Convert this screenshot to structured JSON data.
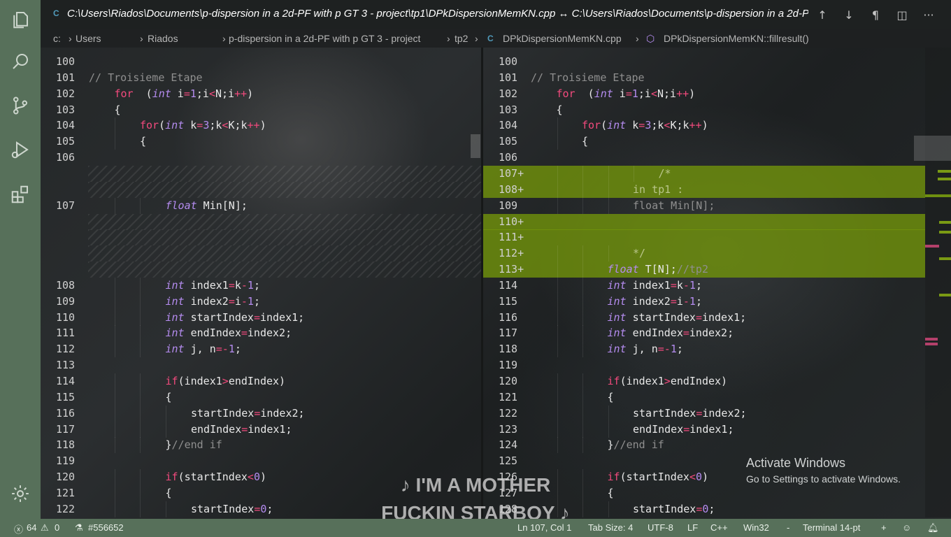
{
  "titlebar": {
    "file_icon": "C",
    "title": "C:\\Users\\Riados\\Documents\\p-dispersion in a 2d-PF with p GT 3 - project\\tp1\\DPkDispersionMemKN.cpp ↔ C:\\Users\\Riados\\Documents\\p-dispersion in a 2d-PF with p GT 3 - project\\tp2\\DPkDispersionMemKN.cpp",
    "icons": [
      "arrow-up-icon",
      "arrow-down-icon",
      "pilcrow-icon",
      "split-editor-icon",
      "more-icon"
    ]
  },
  "breadcrumb": {
    "items": [
      "c:",
      "Users",
      "Riados",
      "Documents",
      "p-dispersion in a 2d-PF with p GT 3 - project",
      "tp2",
      "DPkDispersionMemKN.cpp",
      "DPkDispersionMemKN::fillresult()"
    ],
    "file_icon": "C"
  },
  "activity_bar": {
    "icons": [
      "explorer-icon",
      "search-icon",
      "source-control-icon",
      "run-debug-icon",
      "extensions-icon",
      "settings-gear-icon"
    ]
  },
  "left_lines": [
    {
      "n": "100",
      "indent": 0,
      "tokens": []
    },
    {
      "n": "101",
      "indent": 0,
      "tokens": [
        [
          "cm",
          "// Troisieme Etape"
        ]
      ]
    },
    {
      "n": "102",
      "indent": 1,
      "tokens": [
        [
          "kw",
          "for"
        ],
        [
          "",
          "  ("
        ],
        [
          "ty",
          "int"
        ],
        [
          "",
          " i"
        ],
        [
          "op",
          "="
        ],
        [
          "num",
          "1"
        ],
        [
          "",
          ";i"
        ],
        [
          "op",
          "<"
        ],
        [
          "",
          "N;i"
        ],
        [
          "op",
          "++"
        ],
        [
          "",
          ")"
        ]
      ]
    },
    {
      "n": "103",
      "indent": 1,
      "tokens": [
        [
          "",
          "{"
        ]
      ]
    },
    {
      "n": "104",
      "indent": 2,
      "tokens": [
        [
          "kw",
          "for"
        ],
        [
          "",
          "("
        ],
        [
          "ty",
          "int"
        ],
        [
          "",
          " k"
        ],
        [
          "op",
          "="
        ],
        [
          "num",
          "3"
        ],
        [
          "",
          ";k"
        ],
        [
          "op",
          "<"
        ],
        [
          "",
          "K;k"
        ],
        [
          "op",
          "++"
        ],
        [
          "",
          ")"
        ]
      ]
    },
    {
      "n": "105",
      "indent": 2,
      "tokens": [
        [
          "",
          "{"
        ]
      ]
    },
    {
      "n": "106",
      "indent": 0,
      "tokens": []
    },
    {
      "n": "",
      "indent": 0,
      "tokens": [],
      "hatch": true
    },
    {
      "n": "",
      "indent": 0,
      "tokens": [],
      "hatch": true
    },
    {
      "n": "107",
      "indent": 3,
      "tokens": [
        [
          "ty",
          "float"
        ],
        [
          "",
          " Min[N];"
        ]
      ]
    },
    {
      "n": "",
      "indent": 0,
      "tokens": [],
      "hatch": true
    },
    {
      "n": "",
      "indent": 0,
      "tokens": [],
      "hatch": true
    },
    {
      "n": "",
      "indent": 0,
      "tokens": [],
      "hatch": true
    },
    {
      "n": "",
      "indent": 0,
      "tokens": [],
      "hatch": true
    },
    {
      "n": "108",
      "indent": 3,
      "tokens": [
        [
          "ty",
          "int"
        ],
        [
          "",
          " index1"
        ],
        [
          "op",
          "="
        ],
        [
          "",
          "k"
        ],
        [
          "op",
          "-"
        ],
        [
          "num",
          "1"
        ],
        [
          "",
          ";"
        ]
      ]
    },
    {
      "n": "109",
      "indent": 3,
      "tokens": [
        [
          "ty",
          "int"
        ],
        [
          "",
          " index2"
        ],
        [
          "op",
          "="
        ],
        [
          "",
          "i"
        ],
        [
          "op",
          "-"
        ],
        [
          "num",
          "1"
        ],
        [
          "",
          ";"
        ]
      ]
    },
    {
      "n": "110",
      "indent": 3,
      "tokens": [
        [
          "ty",
          "int"
        ],
        [
          "",
          " startIndex"
        ],
        [
          "op",
          "="
        ],
        [
          "",
          "index1;"
        ]
      ]
    },
    {
      "n": "111",
      "indent": 3,
      "tokens": [
        [
          "ty",
          "int"
        ],
        [
          "",
          " endIndex"
        ],
        [
          "op",
          "="
        ],
        [
          "",
          "index2;"
        ]
      ]
    },
    {
      "n": "112",
      "indent": 3,
      "tokens": [
        [
          "ty",
          "int"
        ],
        [
          "",
          " j, n"
        ],
        [
          "op",
          "=-"
        ],
        [
          "num",
          "1"
        ],
        [
          "",
          ";"
        ]
      ]
    },
    {
      "n": "113",
      "indent": 0,
      "tokens": []
    },
    {
      "n": "114",
      "indent": 3,
      "tokens": [
        [
          "kw",
          "if"
        ],
        [
          "",
          "(index1"
        ],
        [
          "op",
          ">"
        ],
        [
          "",
          "endIndex)"
        ]
      ]
    },
    {
      "n": "115",
      "indent": 3,
      "tokens": [
        [
          "",
          "{"
        ]
      ]
    },
    {
      "n": "116",
      "indent": 4,
      "tokens": [
        [
          "",
          "startIndex"
        ],
        [
          "op",
          "="
        ],
        [
          "",
          "index2;"
        ]
      ]
    },
    {
      "n": "117",
      "indent": 4,
      "tokens": [
        [
          "",
          "endIndex"
        ],
        [
          "op",
          "="
        ],
        [
          "",
          "index1;"
        ]
      ]
    },
    {
      "n": "118",
      "indent": 3,
      "tokens": [
        [
          "",
          "}"
        ],
        [
          "cm",
          "//end if"
        ]
      ]
    },
    {
      "n": "119",
      "indent": 0,
      "tokens": []
    },
    {
      "n": "120",
      "indent": 3,
      "tokens": [
        [
          "kw",
          "if"
        ],
        [
          "",
          "(startIndex"
        ],
        [
          "op",
          "<"
        ],
        [
          "num",
          "0"
        ],
        [
          "",
          ")"
        ]
      ]
    },
    {
      "n": "121",
      "indent": 3,
      "tokens": [
        [
          "",
          "{"
        ]
      ]
    },
    {
      "n": "122",
      "indent": 4,
      "tokens": [
        [
          "",
          "startIndex"
        ],
        [
          "op",
          "="
        ],
        [
          "num",
          "0"
        ],
        [
          "",
          ";"
        ]
      ]
    }
  ],
  "right_lines": [
    {
      "n": "100",
      "indent": 0,
      "tokens": []
    },
    {
      "n": "101",
      "indent": 0,
      "tokens": [
        [
          "cm",
          "// Troisieme Etape"
        ]
      ]
    },
    {
      "n": "102",
      "indent": 1,
      "tokens": [
        [
          "kw",
          "for"
        ],
        [
          "",
          "  ("
        ],
        [
          "ty",
          "int"
        ],
        [
          "",
          " i"
        ],
        [
          "op",
          "="
        ],
        [
          "num",
          "1"
        ],
        [
          "",
          ";i"
        ],
        [
          "op",
          "<"
        ],
        [
          "",
          "N;i"
        ],
        [
          "op",
          "++"
        ],
        [
          "",
          ")"
        ]
      ]
    },
    {
      "n": "103",
      "indent": 1,
      "tokens": [
        [
          "",
          "{"
        ]
      ]
    },
    {
      "n": "104",
      "indent": 2,
      "tokens": [
        [
          "kw",
          "for"
        ],
        [
          "",
          "("
        ],
        [
          "ty",
          "int"
        ],
        [
          "",
          " k"
        ],
        [
          "op",
          "="
        ],
        [
          "num",
          "3"
        ],
        [
          "",
          ";k"
        ],
        [
          "op",
          "<"
        ],
        [
          "",
          "K;k"
        ],
        [
          "op",
          "++"
        ],
        [
          "",
          ")"
        ]
      ]
    },
    {
      "n": "105",
      "indent": 2,
      "tokens": [
        [
          "",
          "{"
        ]
      ]
    },
    {
      "n": "106",
      "indent": 0,
      "tokens": []
    },
    {
      "n": "107+",
      "indent": 5,
      "tokens": [
        [
          "cmi",
          "/*"
        ]
      ],
      "ins": true
    },
    {
      "n": "108+",
      "indent": 4,
      "tokens": [
        [
          "cmi",
          "in tp1 :"
        ]
      ],
      "ins": true
    },
    {
      "n": "109",
      "indent": 4,
      "tokens": [
        [
          "cm",
          "float Min[N];"
        ]
      ]
    },
    {
      "n": "110+",
      "indent": 0,
      "tokens": [],
      "ins": true
    },
    {
      "n": "111+",
      "indent": 0,
      "tokens": [],
      "ins": true
    },
    {
      "n": "112+",
      "indent": 4,
      "tokens": [
        [
          "cmi",
          "*/"
        ]
      ],
      "ins": true
    },
    {
      "n": "113+",
      "indent": 3,
      "tokens": [
        [
          "ty",
          "float"
        ],
        [
          "",
          " T[N];"
        ],
        [
          "cm",
          "//tp2"
        ]
      ],
      "ins": true
    },
    {
      "n": "114",
      "indent": 3,
      "tokens": [
        [
          "ty",
          "int"
        ],
        [
          "",
          " index1"
        ],
        [
          "op",
          "="
        ],
        [
          "",
          "k"
        ],
        [
          "op",
          "-"
        ],
        [
          "num",
          "1"
        ],
        [
          "",
          ";"
        ]
      ]
    },
    {
      "n": "115",
      "indent": 3,
      "tokens": [
        [
          "ty",
          "int"
        ],
        [
          "",
          " index2"
        ],
        [
          "op",
          "="
        ],
        [
          "",
          "i"
        ],
        [
          "op",
          "-"
        ],
        [
          "num",
          "1"
        ],
        [
          "",
          ";"
        ]
      ]
    },
    {
      "n": "116",
      "indent": 3,
      "tokens": [
        [
          "ty",
          "int"
        ],
        [
          "",
          " startIndex"
        ],
        [
          "op",
          "="
        ],
        [
          "",
          "index1;"
        ]
      ]
    },
    {
      "n": "117",
      "indent": 3,
      "tokens": [
        [
          "ty",
          "int"
        ],
        [
          "",
          " endIndex"
        ],
        [
          "op",
          "="
        ],
        [
          "",
          "index2;"
        ]
      ]
    },
    {
      "n": "118",
      "indent": 3,
      "tokens": [
        [
          "ty",
          "int"
        ],
        [
          "",
          " j, n"
        ],
        [
          "op",
          "=-"
        ],
        [
          "num",
          "1"
        ],
        [
          "",
          ";"
        ]
      ]
    },
    {
      "n": "119",
      "indent": 0,
      "tokens": []
    },
    {
      "n": "120",
      "indent": 3,
      "tokens": [
        [
          "kw",
          "if"
        ],
        [
          "",
          "(index1"
        ],
        [
          "op",
          ">"
        ],
        [
          "",
          "endIndex)"
        ]
      ]
    },
    {
      "n": "121",
      "indent": 3,
      "tokens": [
        [
          "",
          "{"
        ]
      ]
    },
    {
      "n": "122",
      "indent": 4,
      "tokens": [
        [
          "",
          "startIndex"
        ],
        [
          "op",
          "="
        ],
        [
          "",
          "index2;"
        ]
      ]
    },
    {
      "n": "123",
      "indent": 4,
      "tokens": [
        [
          "",
          "endIndex"
        ],
        [
          "op",
          "="
        ],
        [
          "",
          "index1;"
        ]
      ]
    },
    {
      "n": "124",
      "indent": 3,
      "tokens": [
        [
          "",
          "}"
        ],
        [
          "cm",
          "//end if"
        ]
      ]
    },
    {
      "n": "125",
      "indent": 0,
      "tokens": []
    },
    {
      "n": "126",
      "indent": 3,
      "tokens": [
        [
          "kw",
          "if"
        ],
        [
          "",
          "(startIndex"
        ],
        [
          "op",
          "<"
        ],
        [
          "num",
          "0"
        ],
        [
          "",
          ")"
        ]
      ]
    },
    {
      "n": "127",
      "indent": 3,
      "tokens": [
        [
          "",
          "{"
        ]
      ]
    },
    {
      "n": "128",
      "indent": 4,
      "tokens": [
        [
          "",
          "startIndex"
        ],
        [
          "op",
          "="
        ],
        [
          "num",
          "0"
        ],
        [
          "",
          ";"
        ]
      ]
    }
  ],
  "watermark": {
    "title": "Activate Windows",
    "subtitle": "Go to Settings to activate Windows."
  },
  "lyric": {
    "line1": "♪ I'M A MOTHER",
    "line2": "FUCKIN STARBOY ♪"
  },
  "status": {
    "errors": "64",
    "warnings": "0",
    "color_value": "#556652",
    "position": "Ln 107, Col 1",
    "tab_size": "Tab Size: 4",
    "encoding": "UTF-8",
    "eol": "LF",
    "language": "C++",
    "config": "Win32",
    "dash": "-",
    "terminal": "Terminal 14-pt",
    "plus": "+"
  },
  "colors": {
    "activity_bar": "#57705a",
    "status_bar": "#57705a",
    "keyword": "#f24a7d",
    "type": "#b58cf0",
    "comment": "#8f8f8f",
    "inserted": "#73960a"
  }
}
